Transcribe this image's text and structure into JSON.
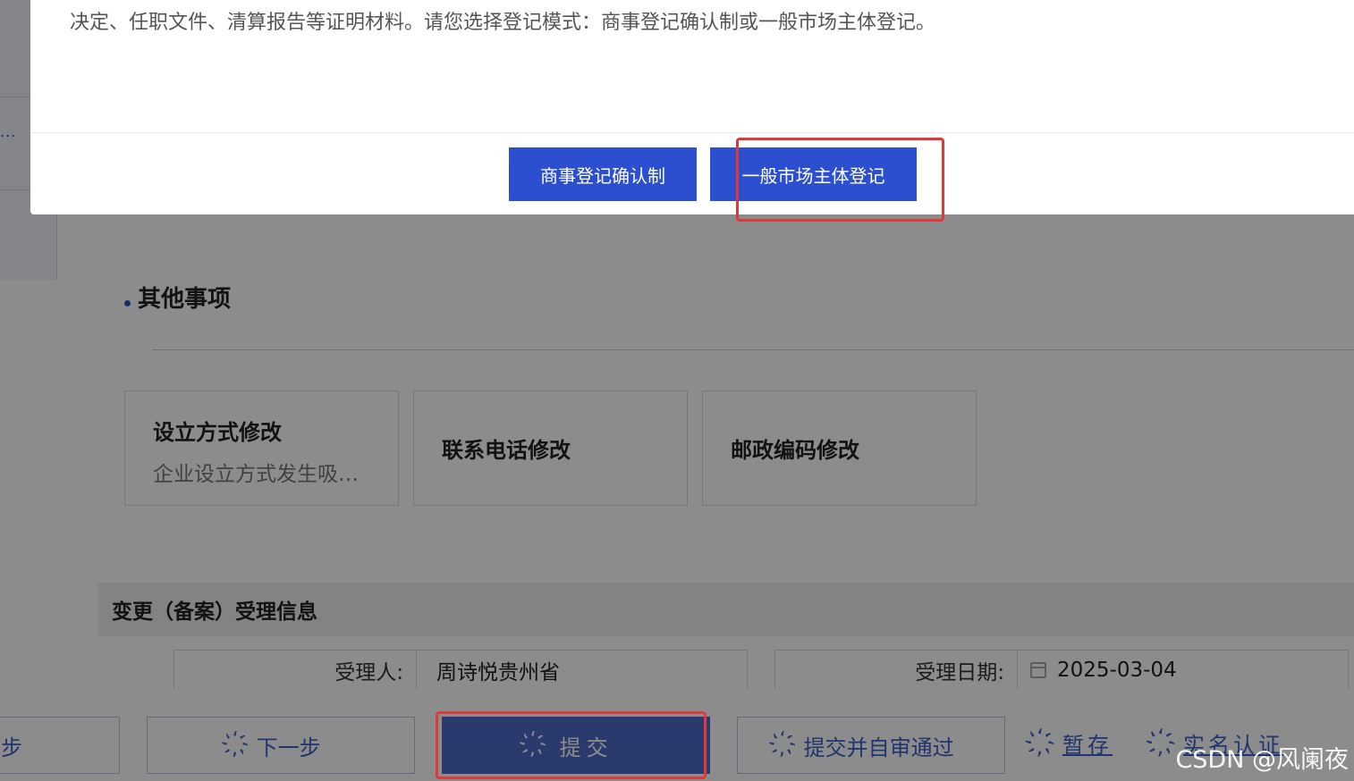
{
  "modal": {
    "body_text": "决定、任职文件、清算报告等证明材料。请您选择登记模式：商事登记确认制或一般市场主体登记。",
    "btn_confirm_mode": "商事登记确认制",
    "btn_general_mode": "一般市场主体登记"
  },
  "sidebar": {
    "ellipsis": "..."
  },
  "other_items": {
    "title": "其他事项",
    "cards": [
      {
        "title": "设立方式修改",
        "desc": "企业设立方式发生吸…"
      },
      {
        "title": "联系电话修改"
      },
      {
        "title": "邮政编码修改"
      }
    ]
  },
  "acceptance": {
    "title": "变更（备案）受理信息",
    "handler_label": "受理人:",
    "handler_value": "周诗悦贵州省",
    "date_label": "受理日期:",
    "date_value": "2025-03-04"
  },
  "actions": {
    "prev": "步",
    "next": "下一步",
    "submit": "提交",
    "submit_approve": "提交并自审通过",
    "save_draft": "暂存",
    "realname": "实名认证",
    "spinner": "҉"
  },
  "watermark": "CSDN @风阑夜"
}
